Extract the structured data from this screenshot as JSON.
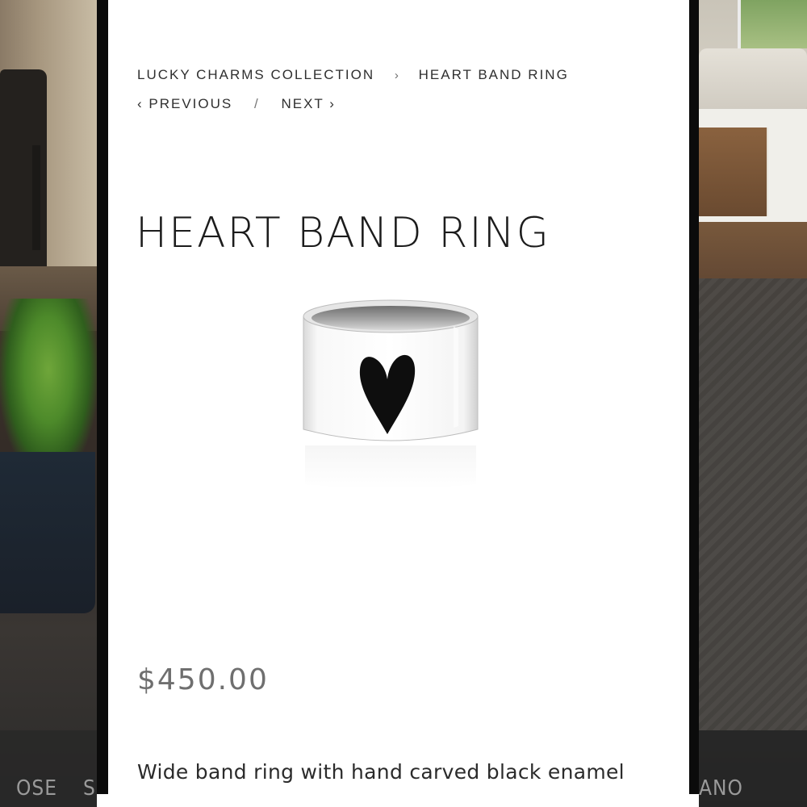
{
  "background": {
    "left_text": "OSE",
    "left_text2": "S",
    "right_text": "ANO"
  },
  "breadcrumb": {
    "collection": "LUCKY CHARMS COLLECTION",
    "separator": "›",
    "current": "HEART BAND RING"
  },
  "pager": {
    "previous": "‹ PREVIOUS",
    "separator": "/",
    "next": "NEXT ›"
  },
  "product": {
    "title": "HEART BAND RING",
    "price": "$450.00",
    "description": "Wide band ring with hand carved black enamel heart.  Stunning, simple and strong.  Made of",
    "image_icon": "heart-band-ring-image"
  },
  "colors": {
    "panel": "#ffffff",
    "frame": "#0b0b0b",
    "text": "#2f2f2f",
    "price": "#6f6f6f"
  }
}
